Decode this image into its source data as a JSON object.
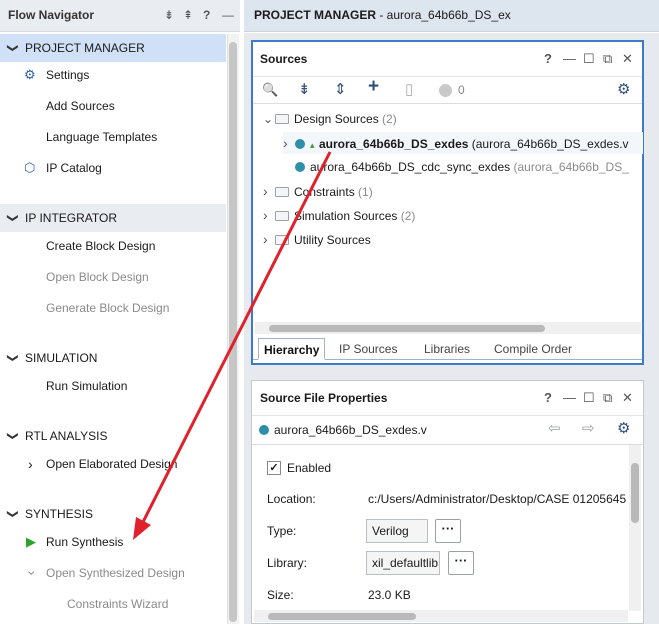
{
  "flow_navigator": {
    "title": "Flow Navigator",
    "header_icons": [
      "collapse-all-icon",
      "expand-all-icon",
      "help-icon",
      "minimize-icon"
    ],
    "header_glyphs": {
      "collapse": "⇟",
      "expand": "⇞",
      "help": "?",
      "minimize": "—"
    },
    "sections": {
      "project_manager": {
        "label": "PROJECT MANAGER",
        "chev": "❯",
        "items": {
          "settings": "Settings",
          "add_sources": "Add Sources",
          "language_templates": "Language Templates",
          "ip_catalog": "IP Catalog"
        },
        "icons": {
          "settings": "⚙",
          "ip_catalog": "⬡"
        }
      },
      "ip_integrator": {
        "label": "IP INTEGRATOR",
        "chev": "❯",
        "items": {
          "create_block_design": "Create Block Design",
          "open_block_design": "Open Block Design",
          "generate_block_design": "Generate Block Design"
        }
      },
      "simulation": {
        "label": "SIMULATION",
        "chev": "❯",
        "items": {
          "run_simulation": "Run Simulation"
        }
      },
      "rtl_analysis": {
        "label": "RTL ANALYSIS",
        "chev": "❯",
        "items": {
          "open_elaborated_design": "Open Elaborated Design"
        },
        "item_chev": "›"
      },
      "synthesis": {
        "label": "SYNTHESIS",
        "chev": "❯",
        "items": {
          "run_synthesis": "Run Synthesis",
          "open_synthesized_design": "Open Synthesized Design",
          "constraints_wizard": "Constraints Wizard"
        },
        "run_icon": "▶",
        "item_chev": "›"
      }
    }
  },
  "project_header": {
    "label": "PROJECT MANAGER",
    "project": " - aurora_64b66b_DS_ex"
  },
  "sources": {
    "title": "Sources",
    "panel_glyphs": {
      "help": "?",
      "minimize": "—",
      "maximize": "☐",
      "float": "⧉",
      "close": "✕"
    },
    "toolbar_glyphs": {
      "search": "🔍",
      "collapse": "⇟",
      "expand": "⇕",
      "add": "+",
      "unknown": "▯",
      "settings": "⚙"
    },
    "status_count": "0",
    "tree": {
      "design_sources": {
        "label": "Design Sources",
        "count": " (2)"
      },
      "file1": {
        "name": "aurora_64b66b_DS_exdes",
        "detail": " (aurora_64b66b_DS_exdes.v"
      },
      "file2": {
        "name": "aurora_64b66b_DS_cdc_sync_exdes",
        "detail": " (aurora_64b66b_DS_"
      },
      "constraints": {
        "label": "Constraints",
        "count": " (1)"
      },
      "simulation_sources": {
        "label": "Simulation Sources",
        "count": " (2)"
      },
      "utility_sources": {
        "label": "Utility Sources"
      }
    },
    "tree_chevs": {
      "open": "⌄",
      "closed": "›"
    },
    "tabs": {
      "hierarchy": "Hierarchy",
      "ip_sources": "IP Sources",
      "libraries": "Libraries",
      "compile_order": "Compile Order"
    }
  },
  "source_file_properties": {
    "title": "Source File Properties",
    "file_name": "aurora_64b66b_DS_exdes.v",
    "nav_glyphs": {
      "back": "⇦",
      "forward": "⇨",
      "settings": "⚙"
    },
    "enabled_label": "Enabled",
    "checkmark": "✓",
    "location_label": "Location:",
    "location_value": "c:/Users/Administrator/Desktop/CASE 01205645",
    "type_label": "Type:",
    "type_value": "Verilog",
    "library_label": "Library:",
    "library_value": "xil_defaultlib",
    "more_label": "···",
    "size_label": "Size:",
    "size_value": "23.0 KB"
  },
  "colors": {
    "active_section_bg": "#cfe0f7",
    "panel_focus_border": "#3f7ac6",
    "annotation_arrow": "#e0202a",
    "run_icon": "#2aa52a",
    "file_dot": "#2f8fa8"
  }
}
